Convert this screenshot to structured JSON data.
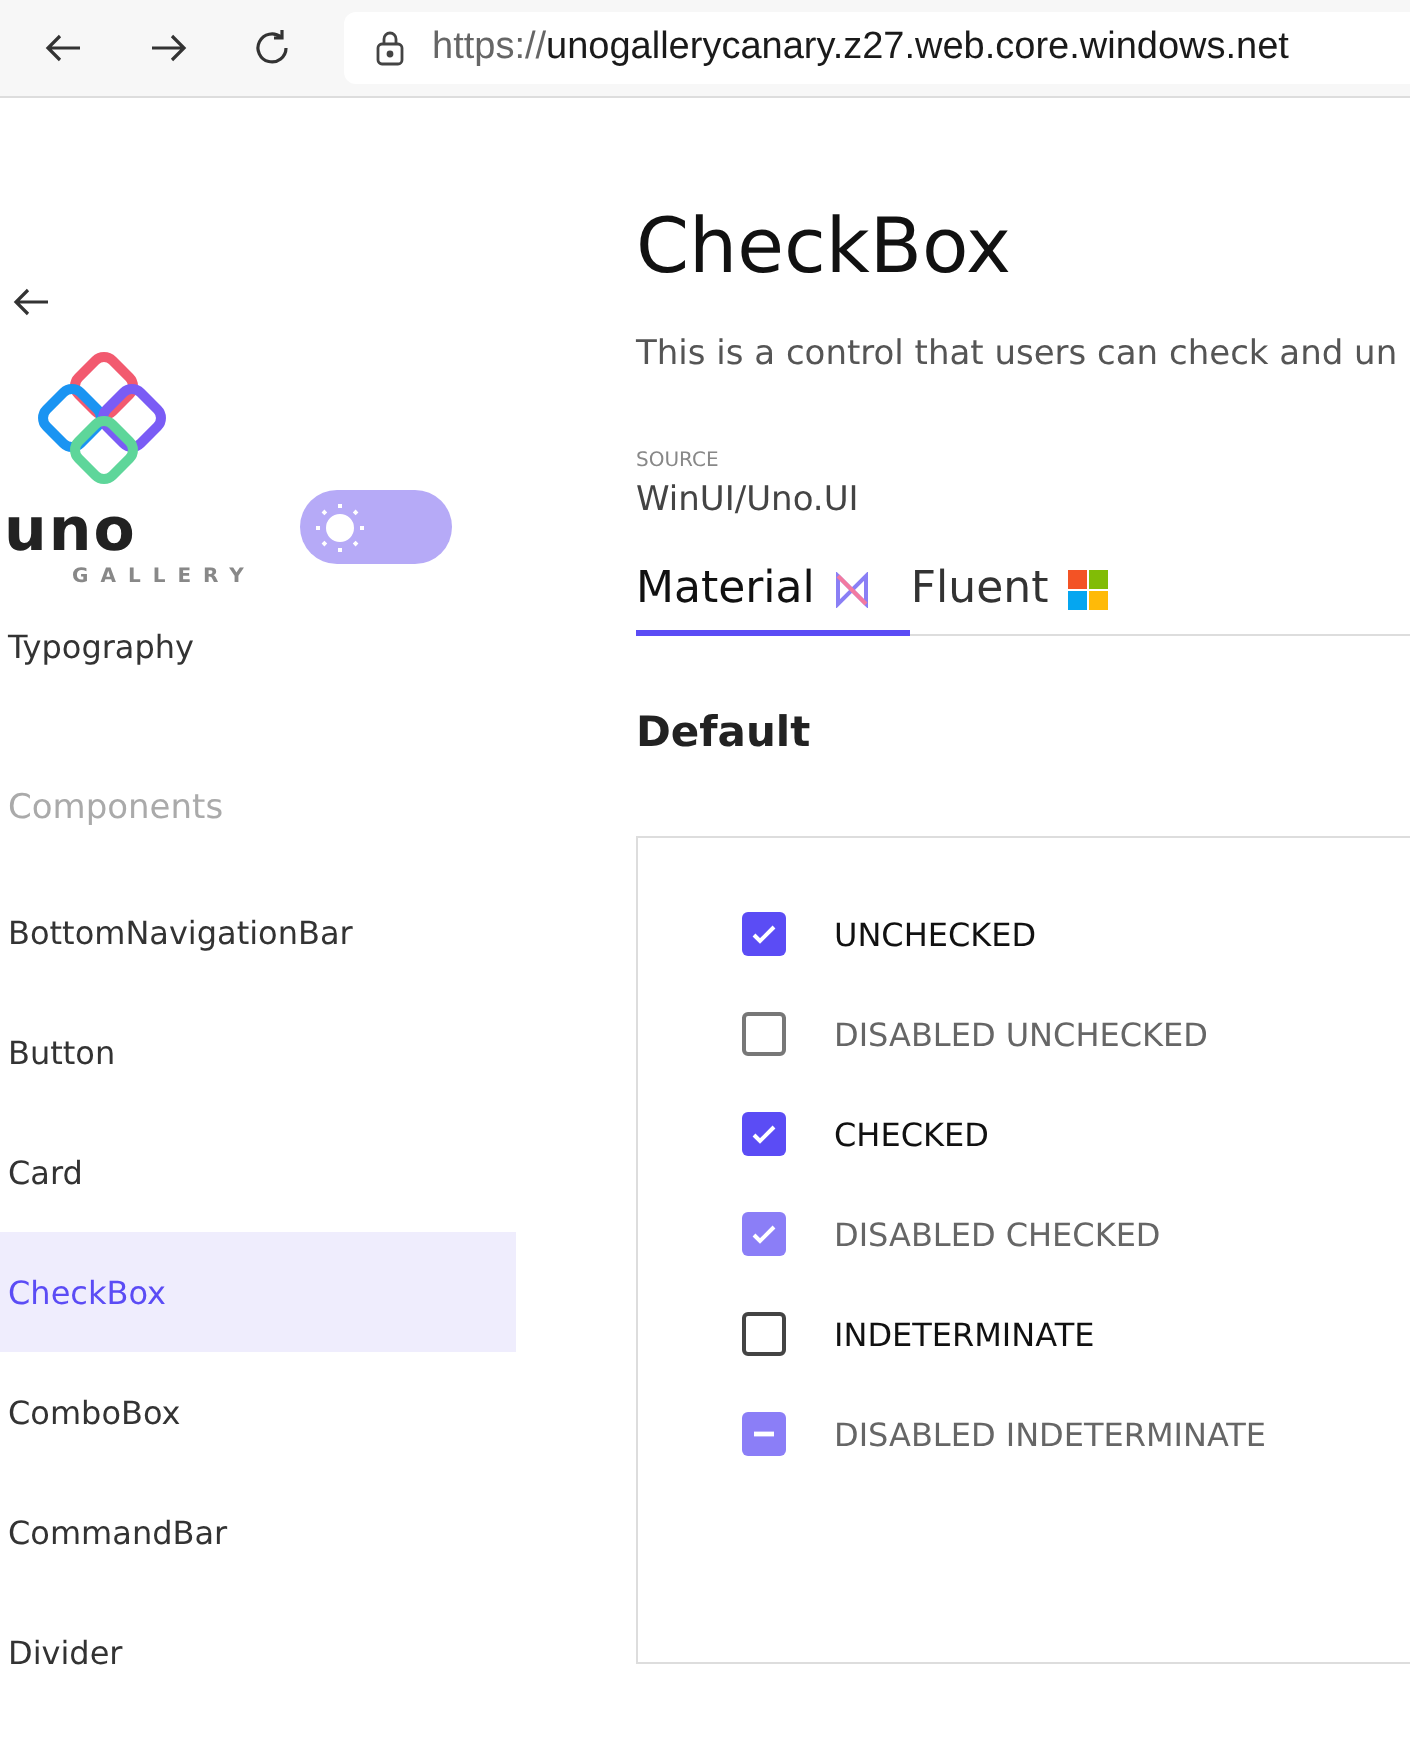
{
  "browser": {
    "url_scheme": "https://",
    "url_host": "unogallerycanary.z27.web.core.windows.net"
  },
  "sidebar": {
    "logo_word": "uno",
    "logo_sub": "GALLERY",
    "theme_toggle": {
      "on": false
    },
    "cut_item": "Typography",
    "section": "Components",
    "items": [
      {
        "label": "BottomNavigationBar",
        "selected": false
      },
      {
        "label": "Button",
        "selected": false
      },
      {
        "label": "Card",
        "selected": false
      },
      {
        "label": "CheckBox",
        "selected": true
      },
      {
        "label": "ComboBox",
        "selected": false
      },
      {
        "label": "CommandBar",
        "selected": false
      },
      {
        "label": "Divider",
        "selected": false
      }
    ]
  },
  "page": {
    "title": "CheckBox",
    "description": "This is a control that users can check and un",
    "source_label": "SOURCE",
    "source": "WinUI/Uno.UI",
    "tabs": [
      {
        "label": "Material",
        "selected": true,
        "kind": "material"
      },
      {
        "label": "Fluent",
        "selected": false,
        "kind": "fluent"
      }
    ],
    "section": "Default",
    "checkboxes": [
      {
        "label": "UNCHECKED",
        "checked": true,
        "indeterminate": false,
        "disabled": false
      },
      {
        "label": "DISABLED UNCHECKED",
        "checked": false,
        "indeterminate": false,
        "disabled": true
      },
      {
        "label": "CHECKED",
        "checked": true,
        "indeterminate": false,
        "disabled": false
      },
      {
        "label": "DISABLED CHECKED",
        "checked": true,
        "indeterminate": false,
        "disabled": true
      },
      {
        "label": "INDETERMINATE",
        "checked": false,
        "indeterminate": false,
        "disabled": false
      },
      {
        "label": "DISABLED INDETERMINATE",
        "checked": false,
        "indeterminate": true,
        "disabled": true
      }
    ]
  }
}
